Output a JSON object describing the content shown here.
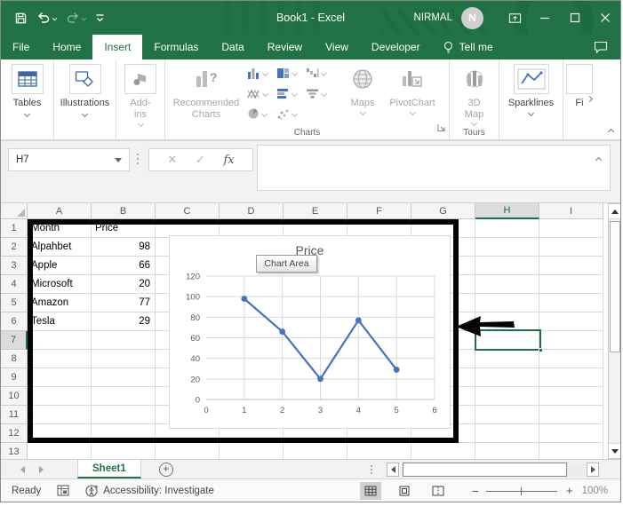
{
  "window": {
    "title": "Book1 - Excel",
    "user_name": "NIRMAL",
    "user_initial": "N"
  },
  "ribbon_tabs": {
    "items": [
      "File",
      "Home",
      "Insert",
      "Formulas",
      "Data",
      "Review",
      "View",
      "Developer"
    ],
    "active": "Insert",
    "tell_me": "Tell me"
  },
  "ribbon": {
    "tables": "Tables",
    "illustrations": "Illustrations",
    "addins": "Add-ins",
    "recommended_charts": "Recommended Charts",
    "charts_group": "Charts",
    "maps": "Maps",
    "pivotchart": "PivotChart",
    "map3d": "3D Map",
    "tours_group": "Tours",
    "sparklines": "Sparklines",
    "filters_partial": "Fi"
  },
  "formula_bar": {
    "name_box": "H7",
    "fx_label": "fx",
    "formula": ""
  },
  "sheet": {
    "column_headers": [
      "A",
      "B",
      "C",
      "D",
      "E",
      "F",
      "G",
      "H",
      "I"
    ],
    "row_headers": [
      "1",
      "2",
      "3",
      "4",
      "5",
      "6",
      "7",
      "8",
      "9",
      "10",
      "11",
      "12",
      "13"
    ],
    "selected_col": "H",
    "selected_row": "7",
    "selected_cell": "H7",
    "rows": [
      {
        "a": "Month",
        "b": "Price"
      },
      {
        "a": "Alpahbet",
        "b": "98"
      },
      {
        "a": "Apple",
        "b": "66"
      },
      {
        "a": "Microsoft",
        "b": "20"
      },
      {
        "a": "Amazon",
        "b": "77"
      },
      {
        "a": "Tesla",
        "b": "29"
      }
    ],
    "sheet_tab": "Sheet1"
  },
  "chart_tooltip": "Chart Area",
  "chart_data": {
    "type": "line",
    "title": "Price",
    "x": [
      1,
      2,
      3,
      4,
      5
    ],
    "series": [
      {
        "name": "Price",
        "values": [
          98,
          66,
          20,
          77,
          29
        ]
      }
    ],
    "categories_source": [
      "Alpahbet",
      "Apple",
      "Microsoft",
      "Amazon",
      "Tesla"
    ],
    "xlim": [
      0,
      6
    ],
    "ylim": [
      0,
      120
    ],
    "x_ticks": [
      0,
      1,
      2,
      3,
      4,
      5,
      6
    ],
    "y_ticks": [
      0,
      20,
      40,
      60,
      80,
      100,
      120
    ],
    "grid": true,
    "legend": false,
    "marker": true,
    "line_color": "#4472C4"
  },
  "status_bar": {
    "ready": "Ready",
    "accessibility": "Accessibility: Investigate",
    "zoom_level": "100%"
  },
  "colors": {
    "excel_green": "#217346",
    "selection_green": "#1E7145",
    "chart_line_blue": "#4472C4"
  }
}
